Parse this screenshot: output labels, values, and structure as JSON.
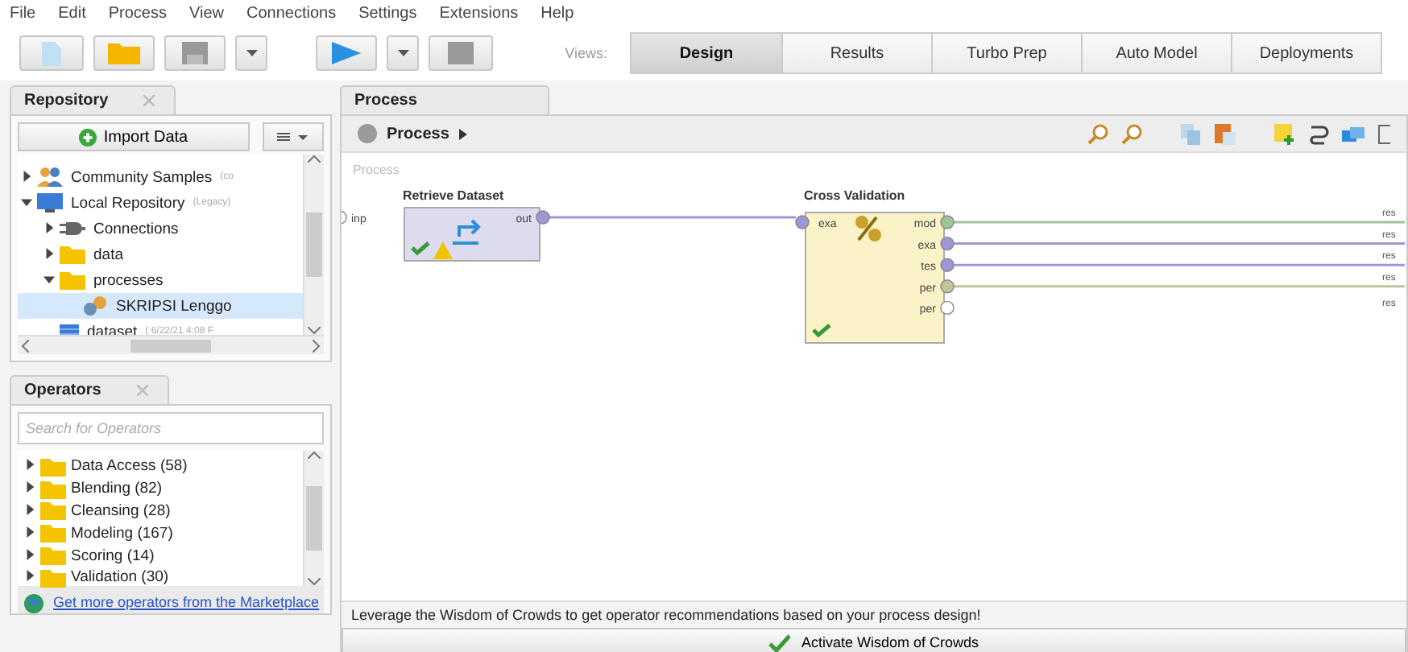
{
  "menu": [
    "File",
    "Edit",
    "Process",
    "View",
    "Connections",
    "Settings",
    "Extensions",
    "Help"
  ],
  "toolbar": {
    "views_label": "Views:",
    "views": [
      {
        "label": "Design",
        "selected": true
      },
      {
        "label": "Results",
        "selected": false
      },
      {
        "label": "Turbo Prep",
        "selected": false
      },
      {
        "label": "Auto Model",
        "selected": false
      },
      {
        "label": "Deployments",
        "selected": false
      }
    ]
  },
  "repository": {
    "title": "Repository",
    "import_button": "Import Data",
    "tree": [
      {
        "label": "Community Samples",
        "note": "(co",
        "kind": "community",
        "expanded": false
      },
      {
        "label": "Local Repository",
        "note": "(Legacy)",
        "kind": "repository",
        "expanded": true,
        "children": [
          {
            "label": "Connections",
            "kind": "connections",
            "expanded": false
          },
          {
            "label": "data",
            "kind": "folder",
            "expanded": false
          },
          {
            "label": "processes",
            "kind": "folder",
            "expanded": true,
            "children": [
              {
                "label": "SKRIPSI Lenggo",
                "kind": "process",
                "selected": true
              }
            ]
          },
          {
            "label": "dataset",
            "note": "( 6/22/21 4:08 F",
            "kind": "data",
            "selected": false
          }
        ]
      }
    ]
  },
  "operators": {
    "title": "Operators",
    "search": {
      "placeholder": "Search for Operators"
    },
    "items": [
      {
        "label": "Data Access (58)",
        "expanded": false
      },
      {
        "label": "Blending (82)",
        "expanded": false
      },
      {
        "label": "Cleansing (28)",
        "expanded": false
      },
      {
        "label": "Modeling (167)",
        "expanded": false
      },
      {
        "label": "Scoring (14)",
        "expanded": false
      },
      {
        "label": "Validation (30)",
        "expanded": false
      }
    ],
    "marketplace_link": "Get more operators from the Marketplace"
  },
  "process": {
    "tab": "Process",
    "breadcrumb": "Process",
    "canvas_label": "Process",
    "input_port": {
      "label": "inp"
    },
    "nodes": [
      {
        "title": "Retrieve Dataset",
        "kind": "retrieve",
        "warning": true,
        "outputs": [
          {
            "label": "out",
            "color": "#9d97d8",
            "connected": true
          }
        ]
      },
      {
        "title": "Cross Validation",
        "kind": "validation",
        "warning": false,
        "inputs": [
          {
            "label": "exa",
            "color": "#9d97d8"
          }
        ],
        "outputs": [
          {
            "label": "mod",
            "color": "#9fc49a",
            "connected": true
          },
          {
            "label": "exa",
            "color": "#9d97d8",
            "connected": true
          },
          {
            "label": "tes",
            "color": "#9d97d8",
            "connected": true
          },
          {
            "label": "per",
            "color": "#c2c39a",
            "connected": true
          },
          {
            "label": "per",
            "color": "#ffffff",
            "connected": false
          }
        ]
      }
    ],
    "results": [
      "res",
      "res",
      "res",
      "res",
      "res"
    ]
  },
  "wisdom": {
    "hint": "Leverage the Wisdom of Crowds to get operator recommendations based on your process design!",
    "button": "Activate Wisdom of Crowds"
  }
}
